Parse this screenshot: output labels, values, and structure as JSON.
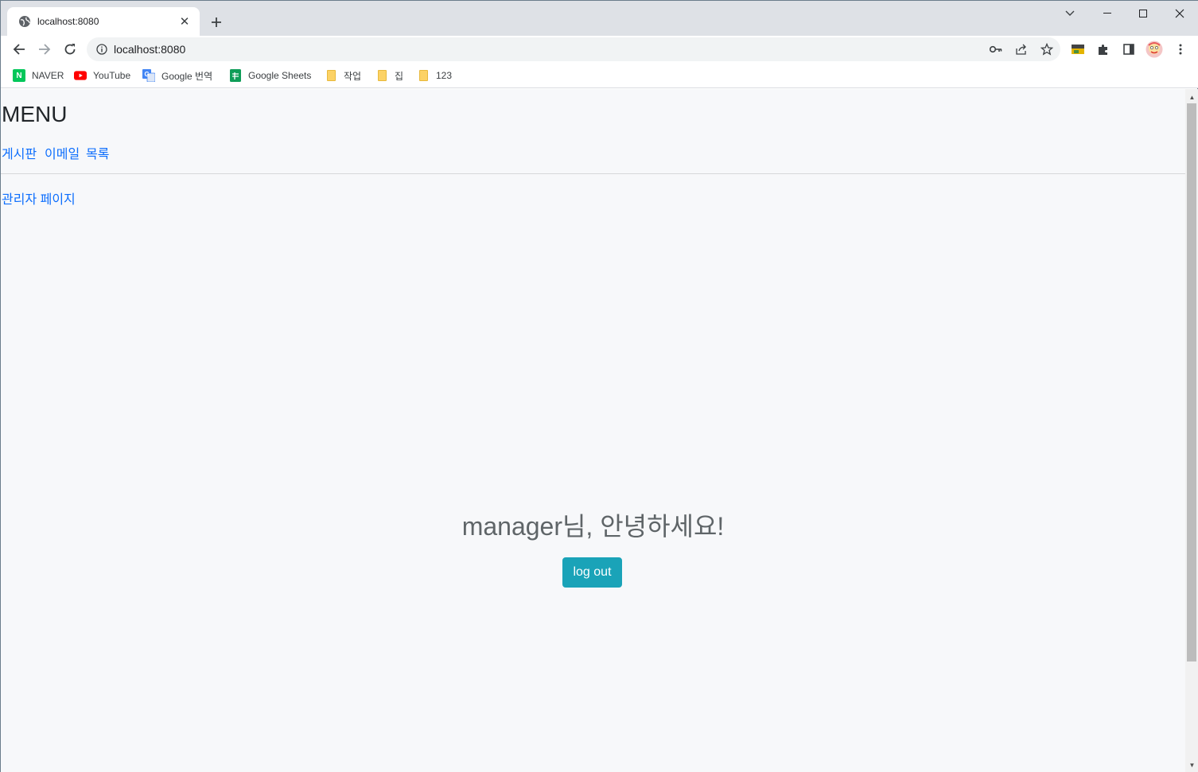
{
  "browser": {
    "tab": {
      "title": "localhost:8080",
      "favicon": "globe-icon"
    },
    "new_tab_icon": "plus-icon",
    "window_controls": [
      "chevron-down-icon",
      "minimize-icon",
      "maximize-icon",
      "close-icon"
    ],
    "address": {
      "url": "localhost:8080",
      "info_icon": "info-icon"
    },
    "omnibox_icons": [
      "key-icon",
      "share-icon",
      "star-icon"
    ],
    "toolbar_icons": [
      "extension-image-icon",
      "puzzle-icon",
      "sidepanel-icon",
      "avatar-icon",
      "more-icon"
    ],
    "bookmarks": [
      {
        "label": "NAVER",
        "icon": "naver-icon",
        "color": "#03c75a"
      },
      {
        "label": "YouTube",
        "icon": "youtube-icon",
        "color": "#ff0000"
      },
      {
        "label": "Google 번역",
        "icon": "translate-icon",
        "color": "#4285f4"
      },
      {
        "label": "Google Sheets",
        "icon": "sheets-icon",
        "color": "#0f9d58"
      },
      {
        "label": "작업",
        "icon": "folder-icon"
      },
      {
        "label": "집",
        "icon": "folder-icon"
      },
      {
        "label": "123",
        "icon": "folder-icon"
      }
    ]
  },
  "page": {
    "menu_title": "MENU",
    "links": {
      "board": "게시판",
      "email": "이메일",
      "list": "목록",
      "admin": "관리자 페이지"
    },
    "greeting": "manager님, 안녕하세요!",
    "logout_label": "log out",
    "colors": {
      "link": "#0d6efd",
      "button": "#1aa3b8",
      "background": "#f7f8fa"
    }
  }
}
